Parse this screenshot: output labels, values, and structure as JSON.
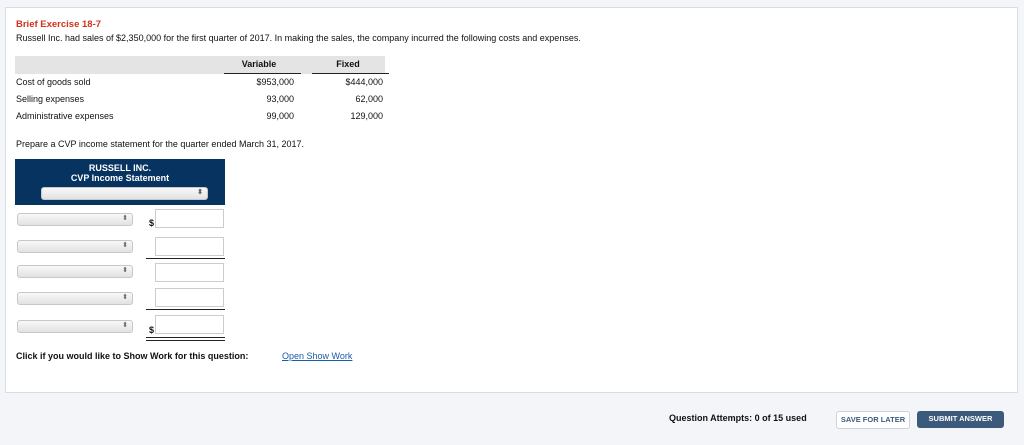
{
  "exercise_title": "Brief Exercise 18-7",
  "intro": "Russell Inc. had sales of $2,350,000 for the first quarter of 2017. In making the sales, the company incurred the following costs and expenses.",
  "table": {
    "headers": [
      "Variable",
      "Fixed"
    ],
    "rows": [
      {
        "label": "Cost of goods sold",
        "variable": "$953,000",
        "fixed": "$444,000"
      },
      {
        "label": "Selling expenses",
        "variable": "93,000",
        "fixed": "62,000"
      },
      {
        "label": "Administrative expenses",
        "variable": "99,000",
        "fixed": "129,000"
      }
    ]
  },
  "instruction": "Prepare a CVP income statement for the quarter ended March 31, 2017.",
  "statement": {
    "company": "RUSSELL INC.",
    "title": "CVP Income Statement",
    "dollar": "$"
  },
  "show_work": {
    "prompt": "Click if you would like to Show Work for this question:",
    "link": "Open Show Work"
  },
  "footer": {
    "attempts": "Question Attempts: 0 of 15 used",
    "save": "SAVE FOR LATER",
    "submit": "SUBMIT ANSWER"
  },
  "colors": {
    "title": "#d0321c",
    "header": "#06335f",
    "submit": "#3b5a7c"
  }
}
